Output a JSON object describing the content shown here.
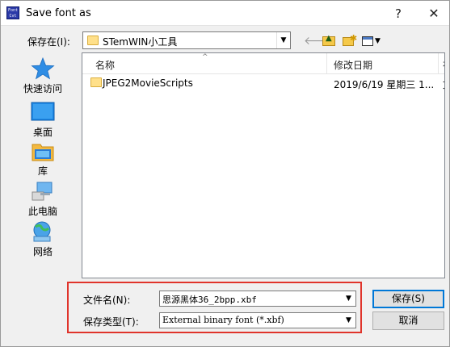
{
  "window": {
    "title": "Save font as",
    "app_icon_text": "Font\nCvt",
    "help_glyph": "?",
    "close_glyph": "✕"
  },
  "location": {
    "label": "保存在(I):",
    "value": "STemWIN小工具"
  },
  "toolbar": {
    "icons": [
      "back-arrow-icon",
      "up-folder-icon",
      "new-folder-icon",
      "view-menu-icon"
    ]
  },
  "places": [
    {
      "label": "快速访问",
      "icon": "star-icon"
    },
    {
      "label": "桌面",
      "icon": "desktop-icon"
    },
    {
      "label": "库",
      "icon": "library-icon"
    },
    {
      "label": "此电脑",
      "icon": "computer-icon"
    },
    {
      "label": "网络",
      "icon": "network-icon"
    }
  ],
  "file_list": {
    "columns": [
      "名称",
      "修改日期",
      "在"
    ],
    "rows": [
      {
        "name": "JPEG2MovieScripts",
        "date": "2019/6/19 星期三 1...",
        "extra": "文"
      }
    ]
  },
  "filename": {
    "label": "文件名(N):",
    "value": "思源黑体36_2bpp.xbf"
  },
  "filetype": {
    "label": "保存类型(T):",
    "value": "External binary font (*.xbf)"
  },
  "buttons": {
    "save": "保存(S)",
    "cancel": "取消"
  },
  "colors": {
    "accent": "#0078d7",
    "highlight": "#e0342b",
    "folder": "#ffe08a"
  }
}
